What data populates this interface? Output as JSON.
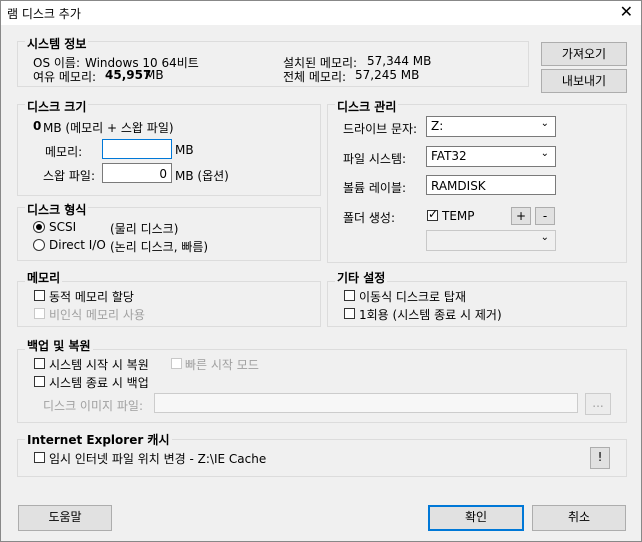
{
  "window": {
    "title": "램 디스크 추가",
    "close_label": "✕"
  },
  "system_info": {
    "label": "시스템 정보",
    "os_label": "OS 이름:",
    "os_value": "Windows 10 64비트",
    "free_label": "여유 메모리:",
    "free_value": "45,957",
    "free_unit": "MB",
    "installed_label": "설치된 메모리:",
    "installed_value": "57,344 MB",
    "total_label": "전체 메모리:",
    "total_value": "57,245 MB"
  },
  "buttons": {
    "import": "가져오기",
    "export": "내보내기",
    "help": "도움말",
    "ok": "확인",
    "cancel": "취소"
  },
  "disk_size": {
    "label": "디스크 크기",
    "total_value": "0",
    "total_suffix": "MB (메모리 + 스왑 파일)",
    "memory_label": "메모리:",
    "memory_value": "",
    "memory_unit": "MB",
    "swap_label": "스왑 파일:",
    "swap_value": "0",
    "swap_unit": "MB (옵션)"
  },
  "disk_mgmt": {
    "label": "디스크 관리",
    "drive_label": "드라이브 문자:",
    "drive_value": "Z:",
    "fs_label": "파일 시스템:",
    "fs_value": "FAT32",
    "volume_label": "볼륨 레이블:",
    "volume_value": "RAMDISK",
    "folder_label": "폴더 생성:",
    "folder_temp": "TEMP",
    "plus": "+",
    "minus": "-",
    "folder_select_value": ""
  },
  "disk_type": {
    "label": "디스크 형식",
    "scsi": "SCSI",
    "scsi_desc": "(물리 디스크)",
    "direct": "Direct I/O",
    "direct_desc": "(논리 디스크, 빠름)"
  },
  "memory": {
    "label": "메모리",
    "dynamic": "동적 메모리 할당",
    "nonpaged": "비인식 메모리 사용"
  },
  "other": {
    "label": "기타 설정",
    "removable": "이동식 디스크로 탑재",
    "onetime": "1회용 (시스템 종료 시 제거)"
  },
  "backup": {
    "label": "백업 및 복원",
    "restore_on_start": "시스템 시작 시 복원",
    "fast_start": "빠른 시작 모드",
    "backup_on_shutdown": "시스템 종료 시 백업",
    "image_label": "디스크 이미지 파일:",
    "image_value": "",
    "browse": "..."
  },
  "ie_cache": {
    "label": "Internet Explorer 캐시",
    "change": "임시 인터넷 파일 위치 변경 - Z:\\IE Cache",
    "info_button": "!"
  }
}
